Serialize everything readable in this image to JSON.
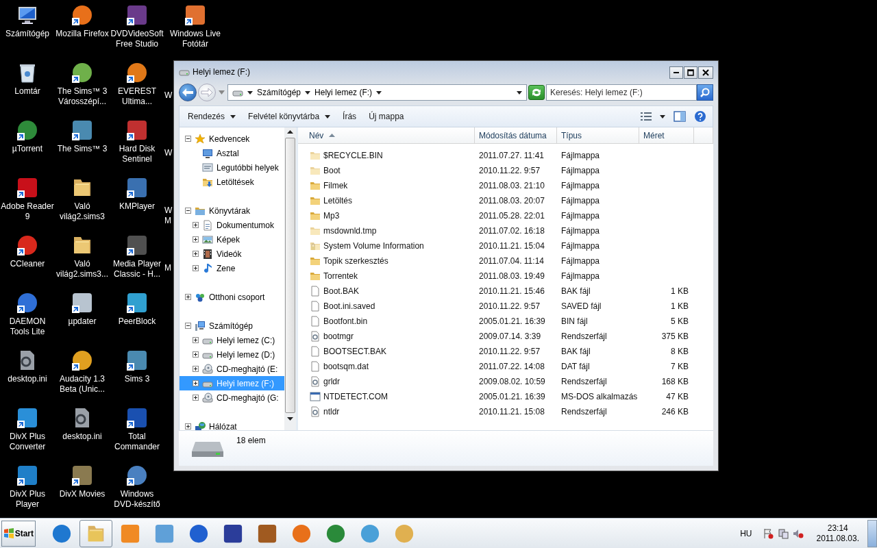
{
  "desktop": {
    "columns": [
      [
        {
          "label": "Számítógép",
          "kind": "computer",
          "shortcut": false
        },
        {
          "label": "Lomtár",
          "kind": "bin",
          "shortcut": false
        },
        {
          "label": "µTorrent",
          "kind": "round",
          "color": "#2e8b3a",
          "shortcut": true
        },
        {
          "label": "Adobe Reader\n9",
          "kind": "square",
          "color": "#c8101a",
          "shortcut": true
        },
        {
          "label": "CCleaner",
          "kind": "round",
          "color": "#d8281c",
          "shortcut": true
        },
        {
          "label": "DAEMON\nTools Lite",
          "kind": "round",
          "color": "#2f6fd6",
          "shortcut": true
        },
        {
          "label": "desktop.ini",
          "kind": "file",
          "shortcut": false
        },
        {
          "label": "DivX Plus\nConverter",
          "kind": "square",
          "color": "#2a8fd8",
          "shortcut": true
        },
        {
          "label": "DivX Plus\nPlayer",
          "kind": "square",
          "color": "#1f7fc8",
          "shortcut": true
        }
      ],
      [
        {
          "label": "Mozilla Firefox",
          "kind": "round",
          "color": "#e8701a",
          "shortcut": true
        },
        {
          "label": "The Sims™ 3\nVárosszépí...",
          "kind": "round",
          "color": "#6fb04a",
          "shortcut": true
        },
        {
          "label": "The Sims™ 3",
          "kind": "square",
          "color": "#4a8ab0",
          "shortcut": true
        },
        {
          "label": "Való\nvilág2.sims3",
          "kind": "folder",
          "shortcut": false
        },
        {
          "label": "Való\nvilág2.sims3...",
          "kind": "folder",
          "shortcut": false
        },
        {
          "label": "µpdater",
          "kind": "square",
          "color": "#b8c4d0",
          "shortcut": true
        },
        {
          "label": "Audacity 1.3\nBeta (Unic...",
          "kind": "round",
          "color": "#e0a020",
          "shortcut": true
        },
        {
          "label": "desktop.ini",
          "kind": "file",
          "shortcut": false
        },
        {
          "label": "DivX Movies",
          "kind": "square",
          "color": "#8a7a50",
          "shortcut": true
        }
      ],
      [
        {
          "label": "DVDVideoSoft\nFree Studio",
          "kind": "square",
          "color": "#6a3a8a",
          "shortcut": true
        },
        {
          "label": "EVEREST\nUltima...",
          "kind": "round",
          "color": "#e07818",
          "shortcut": true
        },
        {
          "label": "Hard Disk\nSentinel",
          "kind": "square",
          "color": "#c03030",
          "shortcut": true
        },
        {
          "label": "KMPlayer",
          "kind": "square",
          "color": "#3a70b0",
          "shortcut": true
        },
        {
          "label": "Media Player\nClassic - H...",
          "kind": "square",
          "color": "#505050",
          "shortcut": true
        },
        {
          "label": "PeerBlock",
          "kind": "square",
          "color": "#30a0d0",
          "shortcut": true
        },
        {
          "label": "Sims 3",
          "kind": "square",
          "color": "#4a8ab0",
          "shortcut": true
        },
        {
          "label": "Total\nCommander",
          "kind": "square",
          "color": "#1a50b0",
          "shortcut": true
        },
        {
          "label": "Windows\nDVD-készítő",
          "kind": "round",
          "color": "#4a80c0",
          "shortcut": true
        }
      ],
      [
        {
          "label": "Windows Live\nFotótár",
          "kind": "square",
          "color": "#e07030",
          "shortcut": true
        },
        {
          "label": "W"
        },
        {
          "label": "W"
        },
        {
          "label": "W\nM"
        },
        {
          "label": "M"
        }
      ]
    ]
  },
  "window": {
    "title": "Helyi lemez (F:)",
    "breadcrumb": [
      "Számítógép",
      "Helyi lemez (F:)"
    ],
    "search": {
      "placeholder": "Keresés: Helyi lemez (F:)"
    },
    "toolbar": [
      {
        "label": "Rendezés",
        "dropdown": true
      },
      {
        "label": "Felvétel könyvtárba",
        "dropdown": true
      },
      {
        "label": "Írás",
        "dropdown": false
      },
      {
        "label": "Új mappa",
        "dropdown": false
      }
    ],
    "nav": {
      "items": [
        {
          "label": "Kedvencek",
          "kind": "star",
          "expanded": true,
          "selected": false,
          "children": [
            {
              "label": "Asztal",
              "kind": "desktop",
              "selected": false
            },
            {
              "label": "Legutóbbi helyek",
              "kind": "recent",
              "selected": false
            },
            {
              "label": "Letöltések",
              "kind": "downloads",
              "selected": false
            }
          ]
        },
        {
          "label": "Könyvtárak",
          "kind": "library",
          "expanded": true,
          "selected": false,
          "children": [
            {
              "label": "Dokumentumok",
              "kind": "document",
              "expanded": false,
              "selected": false
            },
            {
              "label": "Képek",
              "kind": "picture",
              "expanded": false,
              "selected": false
            },
            {
              "label": "Videók",
              "kind": "video",
              "expanded": false,
              "selected": false
            },
            {
              "label": "Zene",
              "kind": "music",
              "expanded": false,
              "selected": false
            }
          ]
        },
        {
          "label": "Otthoni csoport",
          "kind": "homegroup",
          "expanded": false,
          "selected": false
        },
        {
          "label": "Számítógép",
          "kind": "computer",
          "expanded": true,
          "selected": false,
          "children": [
            {
              "label": "Helyi lemez (C:)",
              "kind": "drive",
              "expanded": false,
              "selected": false
            },
            {
              "label": "Helyi lemez (D:)",
              "kind": "drive",
              "expanded": false,
              "selected": false
            },
            {
              "label": "CD-meghajtó (E:",
              "kind": "cd",
              "expanded": false,
              "selected": false
            },
            {
              "label": "Helyi lemez (F:)",
              "kind": "drive",
              "expanded": false,
              "selected": true
            },
            {
              "label": "CD-meghajtó (G:",
              "kind": "cd",
              "expanded": false,
              "selected": false
            }
          ]
        },
        {
          "label": "Hálózat",
          "kind": "network",
          "expanded": false,
          "selected": false
        }
      ]
    },
    "table": {
      "columns": [
        {
          "label": "Név",
          "sorted": true
        },
        {
          "label": "Módosítás dátuma",
          "sorted": false
        },
        {
          "label": "Típus",
          "sorted": false
        },
        {
          "label": "Méret",
          "sorted": false
        }
      ],
      "rows": [
        {
          "name": "$RECYCLE.BIN",
          "kind": "folder",
          "hidden": true,
          "date": "2011.07.27. 11:41",
          "type": "Fájlmappa"
        },
        {
          "name": "Boot",
          "kind": "folder",
          "hidden": true,
          "date": "2010.11.22. 9:57",
          "type": "Fájlmappa"
        },
        {
          "name": "Filmek",
          "kind": "folder",
          "hidden": false,
          "date": "2011.08.03. 21:10",
          "type": "Fájlmappa"
        },
        {
          "name": "Letöltés",
          "kind": "folder",
          "hidden": false,
          "date": "2011.08.03. 20:07",
          "type": "Fájlmappa"
        },
        {
          "name": "Mp3",
          "kind": "folder",
          "hidden": false,
          "date": "2011.05.28. 22:01",
          "type": "Fájlmappa"
        },
        {
          "name": "msdownld.tmp",
          "kind": "folder",
          "hidden": true,
          "date": "2011.07.02. 16:18",
          "type": "Fájlmappa"
        },
        {
          "name": "System Volume Information",
          "kind": "locked",
          "hidden": true,
          "date": "2010.11.21. 15:04",
          "type": "Fájlmappa"
        },
        {
          "name": "Topik szerkesztés",
          "kind": "folder",
          "hidden": false,
          "date": "2011.07.04. 11:14",
          "type": "Fájlmappa"
        },
        {
          "name": "Torrentek",
          "kind": "folder",
          "hidden": false,
          "date": "2011.08.03. 19:49",
          "type": "Fájlmappa"
        },
        {
          "name": "Boot.BAK",
          "kind": "file",
          "hidden": false,
          "date": "2010.11.21. 15:46",
          "type": "BAK fájl",
          "size": "1 KB"
        },
        {
          "name": "Boot.ini.saved",
          "kind": "file",
          "hidden": false,
          "date": "2010.11.22. 9:57",
          "type": "SAVED fájl",
          "size": "1 KB"
        },
        {
          "name": "Bootfont.bin",
          "kind": "file",
          "hidden": false,
          "date": "2005.01.21. 16:39",
          "type": "BIN fájl",
          "size": "5 KB"
        },
        {
          "name": "bootmgr",
          "kind": "sysfile",
          "hidden": false,
          "date": "2009.07.14. 3:39",
          "type": "Rendszerfájl",
          "size": "375 KB"
        },
        {
          "name": "BOOTSECT.BAK",
          "kind": "file",
          "hidden": false,
          "date": "2010.11.22. 9:57",
          "type": "BAK fájl",
          "size": "8 KB"
        },
        {
          "name": "bootsqm.dat",
          "kind": "file",
          "hidden": false,
          "date": "2011.07.22. 14:08",
          "type": "DAT fájl",
          "size": "7 KB"
        },
        {
          "name": "grldr",
          "kind": "sysfile",
          "hidden": false,
          "date": "2009.08.02. 10:59",
          "type": "Rendszerfájl",
          "size": "168 KB"
        },
        {
          "name": "NTDETECT.COM",
          "kind": "app",
          "hidden": false,
          "date": "2005.01.21. 16:39",
          "type": "MS-DOS alkalmazás",
          "size": "47 KB"
        },
        {
          "name": "ntldr",
          "kind": "sysfile",
          "hidden": false,
          "date": "2010.11.21. 15:08",
          "type": "Rendszerfájl",
          "size": "246 KB"
        }
      ]
    },
    "status": "18 elem"
  },
  "taskbar": {
    "start": "Start",
    "items": [
      {
        "kind": "round",
        "color": "#1f78d0",
        "selected": false
      },
      {
        "kind": "folder",
        "color": "#e8c45a",
        "selected": true
      },
      {
        "kind": "square",
        "color": "#f08a24",
        "selected": false
      },
      {
        "kind": "square",
        "color": "#5fa0d8",
        "selected": false
      },
      {
        "kind": "round",
        "color": "#2060d0",
        "selected": false
      },
      {
        "kind": "square",
        "color": "#2b3d9a",
        "selected": false
      },
      {
        "kind": "square",
        "color": "#a05a20",
        "selected": false
      },
      {
        "kind": "round",
        "color": "#e8701a",
        "selected": false
      },
      {
        "kind": "round",
        "color": "#2a8a3a",
        "selected": false
      },
      {
        "kind": "round",
        "color": "#4aa0d8",
        "selected": false
      },
      {
        "kind": "round",
        "color": "#e0b050",
        "selected": false
      }
    ],
    "language": "HU",
    "time": "23:14",
    "date": "2011.08.03."
  }
}
